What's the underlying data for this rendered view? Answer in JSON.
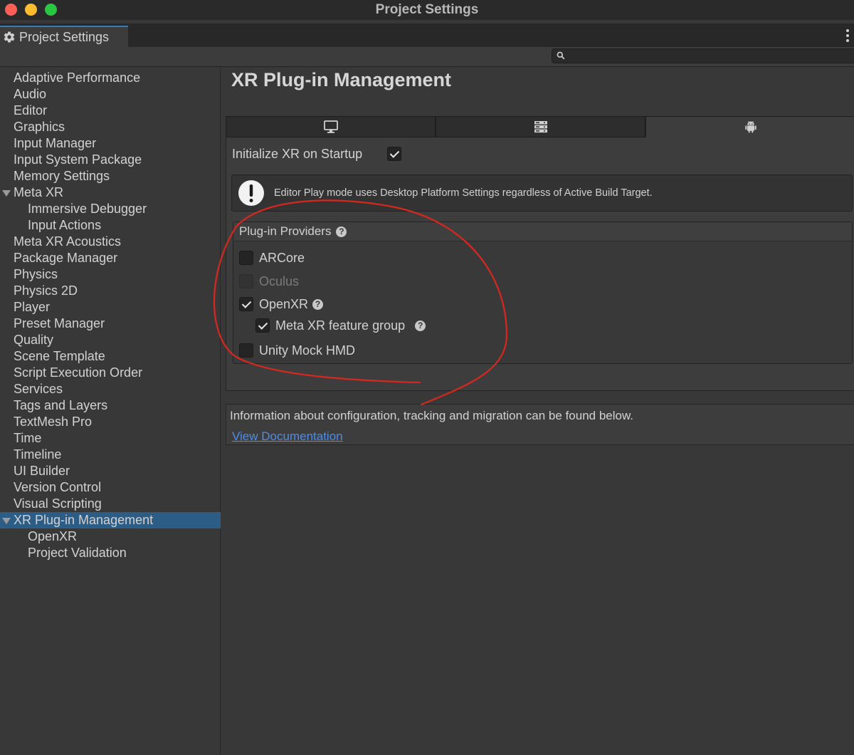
{
  "window": {
    "title": "Project Settings"
  },
  "tab": {
    "label": "Project Settings"
  },
  "search": {
    "value": "",
    "placeholder": ""
  },
  "sidebar": {
    "items": [
      {
        "label": "Adaptive Performance",
        "indent": 0
      },
      {
        "label": "Audio",
        "indent": 0
      },
      {
        "label": "Editor",
        "indent": 0
      },
      {
        "label": "Graphics",
        "indent": 0
      },
      {
        "label": "Input Manager",
        "indent": 0
      },
      {
        "label": "Input System Package",
        "indent": 0
      },
      {
        "label": "Memory Settings",
        "indent": 0
      },
      {
        "label": "Meta XR",
        "indent": 0,
        "expanded": true
      },
      {
        "label": "Immersive Debugger",
        "indent": 1
      },
      {
        "label": "Input Actions",
        "indent": 1
      },
      {
        "label": "Meta XR Acoustics",
        "indent": 0
      },
      {
        "label": "Package Manager",
        "indent": 0
      },
      {
        "label": "Physics",
        "indent": 0
      },
      {
        "label": "Physics 2D",
        "indent": 0
      },
      {
        "label": "Player",
        "indent": 0
      },
      {
        "label": "Preset Manager",
        "indent": 0
      },
      {
        "label": "Quality",
        "indent": 0
      },
      {
        "label": "Scene Template",
        "indent": 0
      },
      {
        "label": "Script Execution Order",
        "indent": 0
      },
      {
        "label": "Services",
        "indent": 0
      },
      {
        "label": "Tags and Layers",
        "indent": 0
      },
      {
        "label": "TextMesh Pro",
        "indent": 0
      },
      {
        "label": "Time",
        "indent": 0
      },
      {
        "label": "Timeline",
        "indent": 0
      },
      {
        "label": "UI Builder",
        "indent": 0
      },
      {
        "label": "Version Control",
        "indent": 0
      },
      {
        "label": "Visual Scripting",
        "indent": 0
      },
      {
        "label": "XR Plug-in Management",
        "indent": 0,
        "expanded": true,
        "selected": true
      },
      {
        "label": "OpenXR",
        "indent": 1
      },
      {
        "label": "Project Validation",
        "indent": 1
      }
    ]
  },
  "main": {
    "title": "XR Plug-in Management",
    "platform_tabs": [
      {
        "icon": "desktop-monitor-icon",
        "active": false
      },
      {
        "icon": "dedicated-server-icon",
        "active": false
      },
      {
        "icon": "android-icon",
        "active": true
      }
    ],
    "init_on_startup": {
      "label": "Initialize XR on Startup",
      "checked": true
    },
    "info_message": "Editor Play mode uses Desktop Platform Settings regardless of Active Build Target.",
    "providers": {
      "title": "Plug-in Providers",
      "items": [
        {
          "label": "ARCore",
          "checked": false,
          "disabled": false,
          "help": false
        },
        {
          "label": "Oculus",
          "checked": false,
          "disabled": true,
          "help": false
        },
        {
          "label": "OpenXR",
          "checked": true,
          "disabled": false,
          "help": true
        },
        {
          "label": "Meta XR feature group",
          "checked": true,
          "disabled": false,
          "help": true,
          "nested": true
        },
        {
          "label": "Unity Mock HMD",
          "checked": false,
          "disabled": false,
          "help": false
        }
      ]
    },
    "documentation": {
      "text": "Information about configuration, tracking and migration can be found below.",
      "link": "View Documentation"
    }
  },
  "colors": {
    "background": "#383838",
    "selection": "#2c5d87",
    "link": "#4d8ce8",
    "annotation": "#d6281f"
  }
}
